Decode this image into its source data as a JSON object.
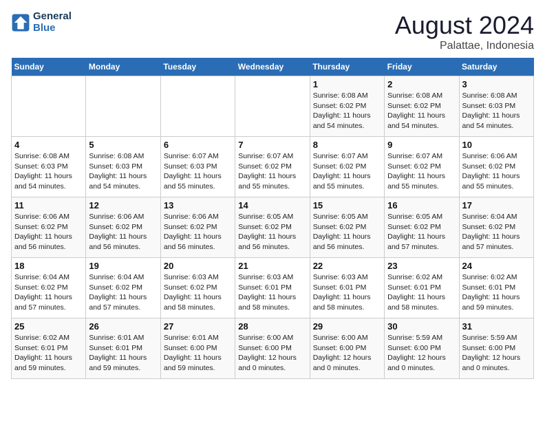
{
  "header": {
    "logo_line1": "General",
    "logo_line2": "Blue",
    "month_year": "August 2024",
    "location": "Palattae, Indonesia"
  },
  "days_of_week": [
    "Sunday",
    "Monday",
    "Tuesday",
    "Wednesday",
    "Thursday",
    "Friday",
    "Saturday"
  ],
  "weeks": [
    [
      {
        "day": "",
        "info": ""
      },
      {
        "day": "",
        "info": ""
      },
      {
        "day": "",
        "info": ""
      },
      {
        "day": "",
        "info": ""
      },
      {
        "day": "1",
        "info": "Sunrise: 6:08 AM\nSunset: 6:02 PM\nDaylight: 11 hours\nand 54 minutes."
      },
      {
        "day": "2",
        "info": "Sunrise: 6:08 AM\nSunset: 6:02 PM\nDaylight: 11 hours\nand 54 minutes."
      },
      {
        "day": "3",
        "info": "Sunrise: 6:08 AM\nSunset: 6:03 PM\nDaylight: 11 hours\nand 54 minutes."
      }
    ],
    [
      {
        "day": "4",
        "info": "Sunrise: 6:08 AM\nSunset: 6:03 PM\nDaylight: 11 hours\nand 54 minutes."
      },
      {
        "day": "5",
        "info": "Sunrise: 6:08 AM\nSunset: 6:03 PM\nDaylight: 11 hours\nand 54 minutes."
      },
      {
        "day": "6",
        "info": "Sunrise: 6:07 AM\nSunset: 6:03 PM\nDaylight: 11 hours\nand 55 minutes."
      },
      {
        "day": "7",
        "info": "Sunrise: 6:07 AM\nSunset: 6:02 PM\nDaylight: 11 hours\nand 55 minutes."
      },
      {
        "day": "8",
        "info": "Sunrise: 6:07 AM\nSunset: 6:02 PM\nDaylight: 11 hours\nand 55 minutes."
      },
      {
        "day": "9",
        "info": "Sunrise: 6:07 AM\nSunset: 6:02 PM\nDaylight: 11 hours\nand 55 minutes."
      },
      {
        "day": "10",
        "info": "Sunrise: 6:06 AM\nSunset: 6:02 PM\nDaylight: 11 hours\nand 55 minutes."
      }
    ],
    [
      {
        "day": "11",
        "info": "Sunrise: 6:06 AM\nSunset: 6:02 PM\nDaylight: 11 hours\nand 56 minutes."
      },
      {
        "day": "12",
        "info": "Sunrise: 6:06 AM\nSunset: 6:02 PM\nDaylight: 11 hours\nand 56 minutes."
      },
      {
        "day": "13",
        "info": "Sunrise: 6:06 AM\nSunset: 6:02 PM\nDaylight: 11 hours\nand 56 minutes."
      },
      {
        "day": "14",
        "info": "Sunrise: 6:05 AM\nSunset: 6:02 PM\nDaylight: 11 hours\nand 56 minutes."
      },
      {
        "day": "15",
        "info": "Sunrise: 6:05 AM\nSunset: 6:02 PM\nDaylight: 11 hours\nand 56 minutes."
      },
      {
        "day": "16",
        "info": "Sunrise: 6:05 AM\nSunset: 6:02 PM\nDaylight: 11 hours\nand 57 minutes."
      },
      {
        "day": "17",
        "info": "Sunrise: 6:04 AM\nSunset: 6:02 PM\nDaylight: 11 hours\nand 57 minutes."
      }
    ],
    [
      {
        "day": "18",
        "info": "Sunrise: 6:04 AM\nSunset: 6:02 PM\nDaylight: 11 hours\nand 57 minutes."
      },
      {
        "day": "19",
        "info": "Sunrise: 6:04 AM\nSunset: 6:02 PM\nDaylight: 11 hours\nand 57 minutes."
      },
      {
        "day": "20",
        "info": "Sunrise: 6:03 AM\nSunset: 6:02 PM\nDaylight: 11 hours\nand 58 minutes."
      },
      {
        "day": "21",
        "info": "Sunrise: 6:03 AM\nSunset: 6:01 PM\nDaylight: 11 hours\nand 58 minutes."
      },
      {
        "day": "22",
        "info": "Sunrise: 6:03 AM\nSunset: 6:01 PM\nDaylight: 11 hours\nand 58 minutes."
      },
      {
        "day": "23",
        "info": "Sunrise: 6:02 AM\nSunset: 6:01 PM\nDaylight: 11 hours\nand 58 minutes."
      },
      {
        "day": "24",
        "info": "Sunrise: 6:02 AM\nSunset: 6:01 PM\nDaylight: 11 hours\nand 59 minutes."
      }
    ],
    [
      {
        "day": "25",
        "info": "Sunrise: 6:02 AM\nSunset: 6:01 PM\nDaylight: 11 hours\nand 59 minutes."
      },
      {
        "day": "26",
        "info": "Sunrise: 6:01 AM\nSunset: 6:01 PM\nDaylight: 11 hours\nand 59 minutes."
      },
      {
        "day": "27",
        "info": "Sunrise: 6:01 AM\nSunset: 6:00 PM\nDaylight: 11 hours\nand 59 minutes."
      },
      {
        "day": "28",
        "info": "Sunrise: 6:00 AM\nSunset: 6:00 PM\nDaylight: 12 hours\nand 0 minutes."
      },
      {
        "day": "29",
        "info": "Sunrise: 6:00 AM\nSunset: 6:00 PM\nDaylight: 12 hours\nand 0 minutes."
      },
      {
        "day": "30",
        "info": "Sunrise: 5:59 AM\nSunset: 6:00 PM\nDaylight: 12 hours\nand 0 minutes."
      },
      {
        "day": "31",
        "info": "Sunrise: 5:59 AM\nSunset: 6:00 PM\nDaylight: 12 hours\nand 0 minutes."
      }
    ]
  ]
}
